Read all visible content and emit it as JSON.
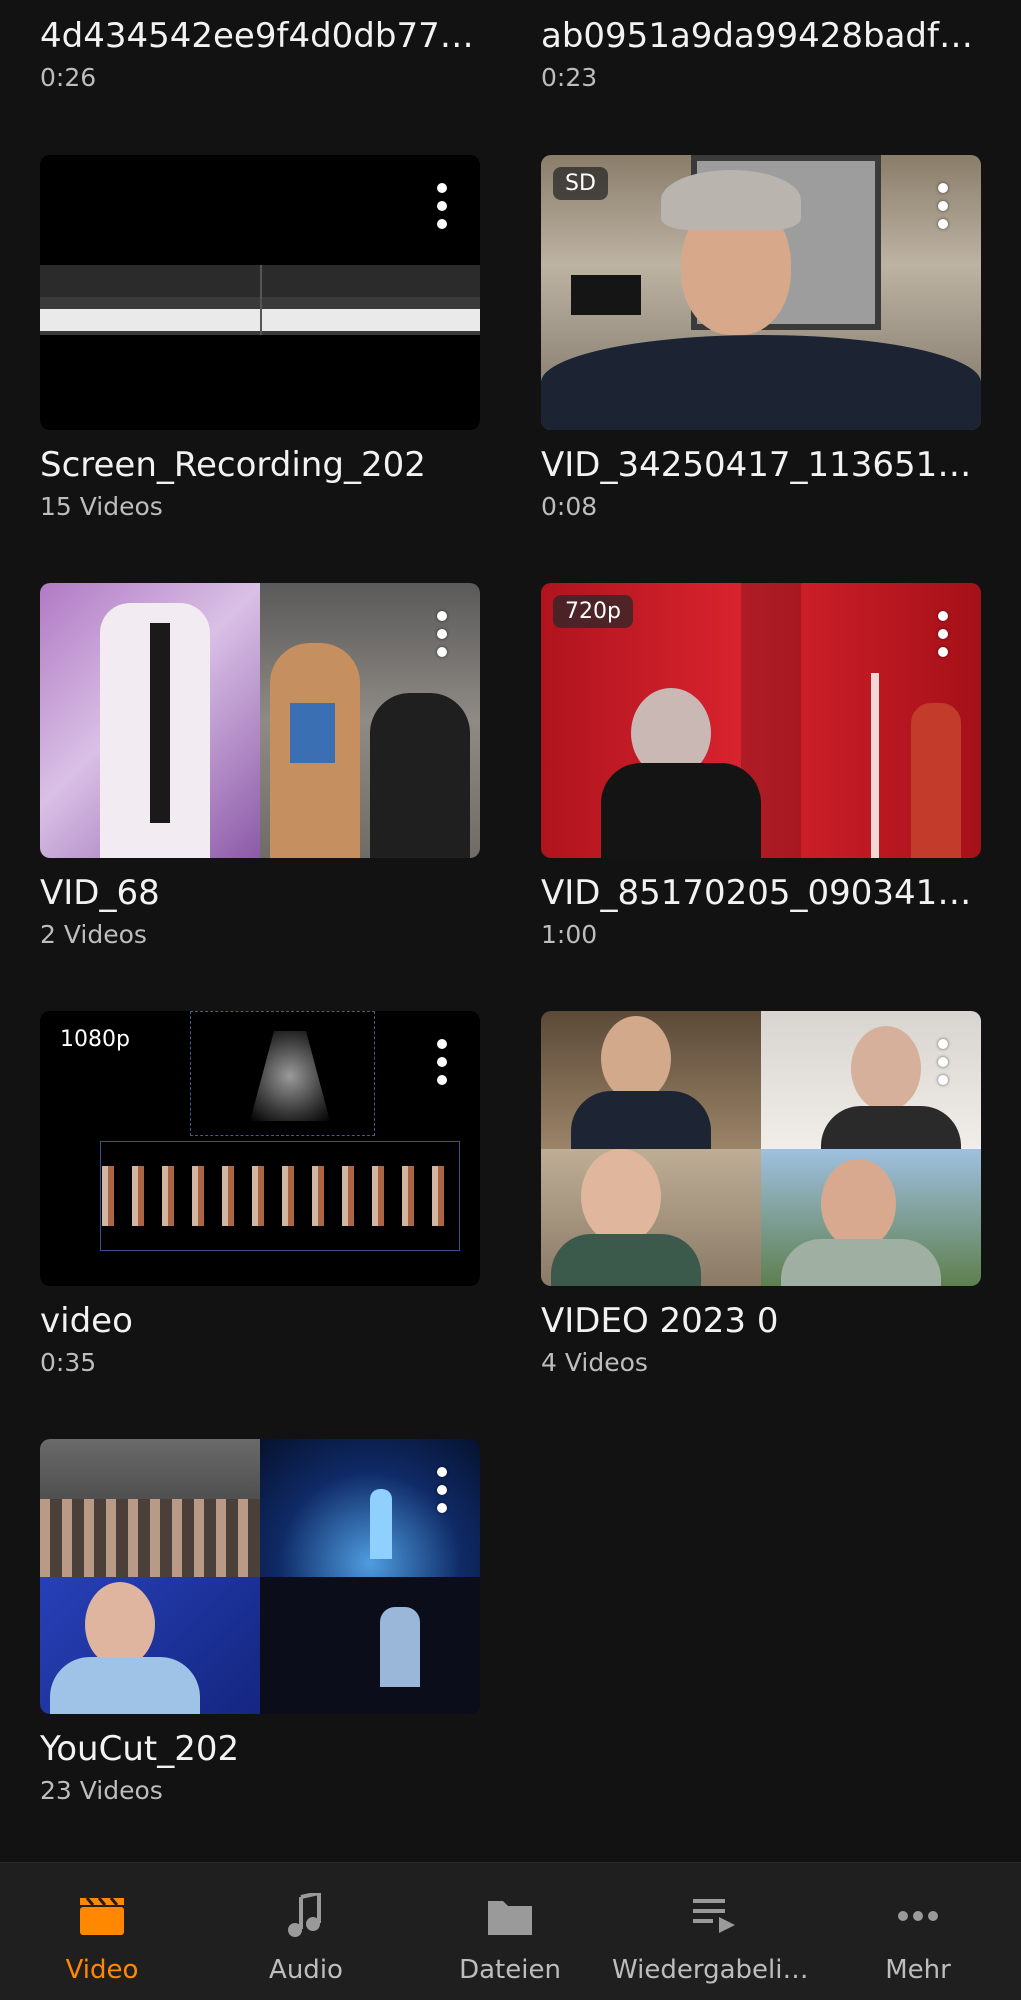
{
  "top_row": [
    {
      "title": "4d434542ee9f4d0db778...",
      "sub": "0:26"
    },
    {
      "title": "ab0951a9da99428badfb...",
      "sub": "0:23"
    }
  ],
  "videos": [
    {
      "title": "Screen_Recording_202",
      "sub": "15 Videos",
      "badge": ""
    },
    {
      "title": "VID_34250417_113651_688",
      "sub": "0:08",
      "badge": "SD"
    },
    {
      "title": "VID_68",
      "sub": "2 Videos",
      "badge": ""
    },
    {
      "title": "VID_85170205_090341_7...",
      "sub": "1:00",
      "badge": "720p"
    },
    {
      "title": "video",
      "sub": "0:35",
      "badge": "1080p"
    },
    {
      "title": "VIDEO 2023 0",
      "sub": "4 Videos",
      "badge": ""
    },
    {
      "title": "YouCut_202",
      "sub": "23 Videos",
      "badge": ""
    }
  ],
  "bottom_nav": [
    {
      "label": "Video",
      "icon": "clapperboard-icon",
      "active": true
    },
    {
      "label": "Audio",
      "icon": "music-note-icon",
      "active": false
    },
    {
      "label": "Dateien",
      "icon": "folder-icon",
      "active": false
    },
    {
      "label": "Wiedergabelist...",
      "icon": "playlist-icon",
      "active": false
    },
    {
      "label": "Mehr",
      "icon": "more-horizontal-icon",
      "active": false
    }
  ],
  "colors": {
    "accent": "#ff8800",
    "background": "#121212",
    "nav_background": "#1f1f1f"
  }
}
